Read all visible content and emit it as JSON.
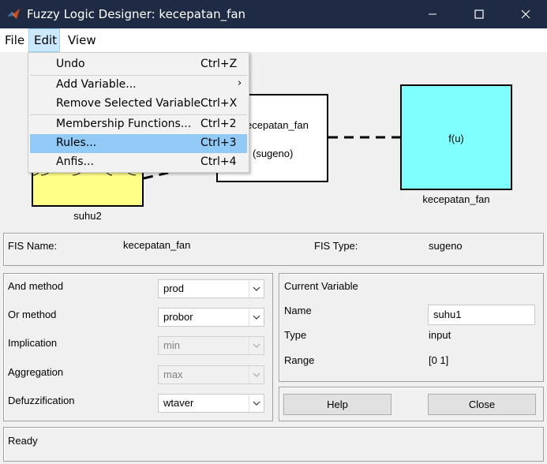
{
  "window": {
    "title": "Fuzzy Logic Designer: kecepatan_fan",
    "icon": "matlab-icon"
  },
  "menubar": {
    "file": "File",
    "edit": "Edit",
    "view": "View"
  },
  "edit_menu": {
    "undo": {
      "label": "Undo",
      "shortcut": "Ctrl+Z"
    },
    "add_variable": {
      "label": "Add Variable...",
      "submenu": "›"
    },
    "remove_variable": {
      "label": "Remove Selected Variable",
      "shortcut": "Ctrl+X"
    },
    "membership": {
      "label": "Membership Functions...",
      "shortcut": "Ctrl+2"
    },
    "rules": {
      "label": "Rules...",
      "shortcut": "Ctrl+3"
    },
    "anfis": {
      "label": "Anfis...",
      "shortcut": "Ctrl+4"
    }
  },
  "diagram": {
    "input_name": "suhu2",
    "fis_name": "ecepatan_fan",
    "fis_type": "(sugeno)",
    "output_fn": "f(u)",
    "output_name": "kecepatan_fan",
    "colors": {
      "input": "#ffff88",
      "output": "#80ffff"
    }
  },
  "fis_info": {
    "name_label": "FIS Name:",
    "name_value": "kecepatan_fan",
    "type_label": "FIS Type:",
    "type_value": "sugeno"
  },
  "methods": {
    "and_label": "And method",
    "and_value": "prod",
    "or_label": "Or method",
    "or_value": "probor",
    "implication_label": "Implication",
    "implication_value": "min",
    "aggregation_label": "Aggregation",
    "aggregation_value": "max",
    "defuzz_label": "Defuzzification",
    "defuzz_value": "wtaver"
  },
  "current_variable": {
    "header": "Current Variable",
    "name_label": "Name",
    "name_value": "suhu1",
    "type_label": "Type",
    "type_value": "input",
    "range_label": "Range",
    "range_value": "[0 1]"
  },
  "buttons": {
    "help": "Help",
    "close": "Close"
  },
  "status": {
    "text": "Ready"
  }
}
